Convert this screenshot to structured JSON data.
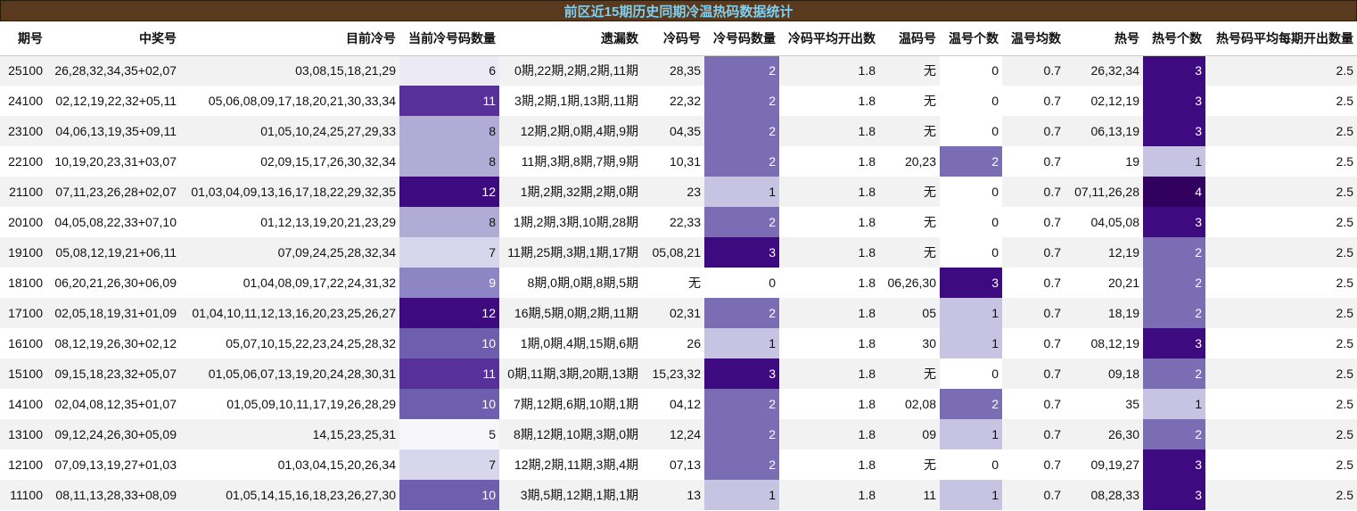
{
  "title": "前区近15期历史同期冷温热码数据统计",
  "headers": [
    "期号",
    "中奖号",
    "目前冷号",
    "当前冷号码数量",
    "遗漏数",
    "冷码号",
    "冷号码数量",
    "冷码平均开出数",
    "温码号",
    "温号个数",
    "温号均数",
    "热号",
    "热号个数",
    "热号码平均每期开出数量"
  ],
  "rows": [
    [
      "25100",
      "26,28,32,34,35+02,07",
      "03,08,15,18,21,29",
      "6",
      "0期,22期,2期,2期,11期",
      "28,35",
      "2",
      "1.8",
      "无",
      "0",
      "0.7",
      "26,32,34",
      "3",
      "2.5"
    ],
    [
      "24100",
      "02,12,19,22,32+05,11",
      "05,06,08,09,17,18,20,21,30,33,34",
      "11",
      "3期,2期,1期,13期,11期",
      "22,32",
      "2",
      "1.8",
      "无",
      "0",
      "0.7",
      "02,12,19",
      "3",
      "2.5"
    ],
    [
      "23100",
      "04,06,13,19,35+09,11",
      "01,05,10,24,25,27,29,33",
      "8",
      "12期,2期,0期,4期,9期",
      "04,35",
      "2",
      "1.8",
      "无",
      "0",
      "0.7",
      "06,13,19",
      "3",
      "2.5"
    ],
    [
      "22100",
      "10,19,20,23,31+03,07",
      "02,09,15,17,26,30,32,34",
      "8",
      "11期,3期,8期,7期,9期",
      "10,31",
      "2",
      "1.8",
      "20,23",
      "2",
      "0.7",
      "19",
      "1",
      "2.5"
    ],
    [
      "21100",
      "07,11,23,26,28+02,07",
      "01,03,04,09,13,16,17,18,22,29,32,35",
      "12",
      "1期,2期,32期,2期,0期",
      "23",
      "1",
      "1.8",
      "无",
      "0",
      "0.7",
      "07,11,26,28",
      "4",
      "2.5"
    ],
    [
      "20100",
      "04,05,08,22,33+07,10",
      "01,12,13,19,20,21,23,29",
      "8",
      "1期,2期,3期,10期,28期",
      "22,33",
      "2",
      "1.8",
      "无",
      "0",
      "0.7",
      "04,05,08",
      "3",
      "2.5"
    ],
    [
      "19100",
      "05,08,12,19,21+06,11",
      "07,09,24,25,28,32,34",
      "7",
      "11期,25期,3期,1期,17期",
      "05,08,21",
      "3",
      "1.8",
      "无",
      "0",
      "0.7",
      "12,19",
      "2",
      "2.5"
    ],
    [
      "18100",
      "06,20,21,26,30+06,09",
      "01,04,08,09,17,22,24,31,32",
      "9",
      "8期,0期,0期,8期,5期",
      "无",
      "0",
      "1.8",
      "06,26,30",
      "3",
      "0.7",
      "20,21",
      "2",
      "2.5"
    ],
    [
      "17100",
      "02,05,18,19,31+01,09",
      "01,04,10,11,12,13,16,20,23,25,26,27",
      "12",
      "16期,5期,0期,2期,11期",
      "02,31",
      "2",
      "1.8",
      "05",
      "1",
      "0.7",
      "18,19",
      "2",
      "2.5"
    ],
    [
      "16100",
      "08,12,19,26,30+02,12",
      "05,07,10,15,22,23,24,25,28,32",
      "10",
      "1期,0期,4期,15期,6期",
      "26",
      "1",
      "1.8",
      "30",
      "1",
      "0.7",
      "08,12,19",
      "3",
      "2.5"
    ],
    [
      "15100",
      "09,15,18,23,32+05,07",
      "01,05,06,07,13,19,20,24,28,30,31",
      "11",
      "0期,11期,3期,20期,13期",
      "15,23,32",
      "3",
      "1.8",
      "无",
      "0",
      "0.7",
      "09,18",
      "2",
      "2.5"
    ],
    [
      "14100",
      "02,04,08,12,35+01,07",
      "01,05,09,10,11,17,19,26,28,29",
      "10",
      "7期,12期,6期,10期,1期",
      "04,12",
      "2",
      "1.8",
      "02,08",
      "2",
      "0.7",
      "35",
      "1",
      "2.5"
    ],
    [
      "13100",
      "09,12,24,26,30+05,09",
      "14,15,23,25,31",
      "5",
      "8期,12期,10期,3期,0期",
      "12,24",
      "2",
      "1.8",
      "09",
      "1",
      "0.7",
      "26,30",
      "2",
      "2.5"
    ],
    [
      "12100",
      "07,09,13,19,27+01,03",
      "01,03,04,15,20,26,34",
      "7",
      "12期,2期,11期,3期,4期",
      "07,13",
      "2",
      "1.8",
      "无",
      "0",
      "0.7",
      "09,19,27",
      "3",
      "2.5"
    ],
    [
      "11100",
      "08,11,13,28,33+08,09",
      "01,05,14,15,16,18,23,26,27,30",
      "10",
      "3期,5期,12期,1期,1期",
      "13",
      "1",
      "1.8",
      "11",
      "1",
      "0.7",
      "08,28,33",
      "3",
      "2.5"
    ]
  ]
}
